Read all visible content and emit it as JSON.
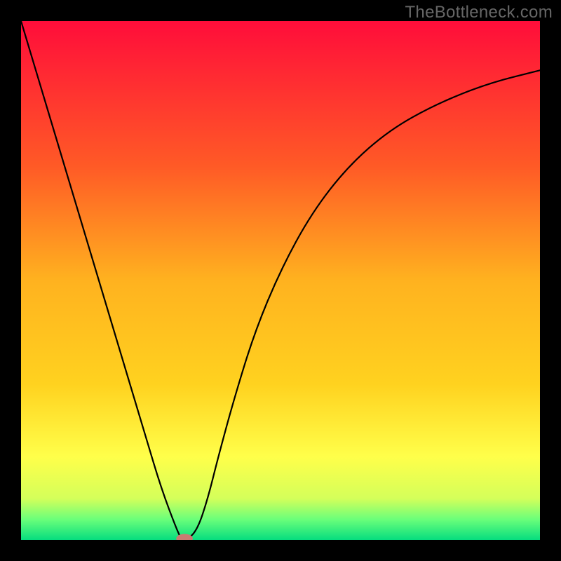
{
  "watermark": "TheBottleneck.com",
  "chart_data": {
    "type": "line",
    "title": "",
    "xlabel": "",
    "ylabel": "",
    "xlim": [
      0,
      100
    ],
    "ylim": [
      0,
      100
    ],
    "background_gradient": {
      "top": "#ff0d3a",
      "upper_mid": "#ff7a1f",
      "mid": "#ffd21f",
      "lower_mid": "#ffff1f",
      "near_bottom": "#9bff5a",
      "bottom": "#06dd7f"
    },
    "series": [
      {
        "name": "bottleneck-curve",
        "color": "#000000",
        "x": [
          0,
          3,
          6,
          9,
          12,
          15,
          18,
          21,
          24,
          27,
          30,
          31,
          32,
          34,
          36,
          38,
          41,
          45,
          50,
          56,
          63,
          71,
          80,
          90,
          100
        ],
        "y": [
          100,
          90,
          80,
          70,
          60,
          50,
          40,
          30,
          20,
          10,
          2,
          0,
          0,
          2,
          8,
          16,
          27,
          40,
          52,
          63,
          72,
          79,
          84,
          88,
          90.5
        ]
      }
    ],
    "marker": {
      "name": "optimal-point",
      "x": 31.5,
      "y": 0,
      "rx": 1.6,
      "ry": 0.9,
      "fill": "#c97a72"
    },
    "grid": false,
    "legend": false
  }
}
